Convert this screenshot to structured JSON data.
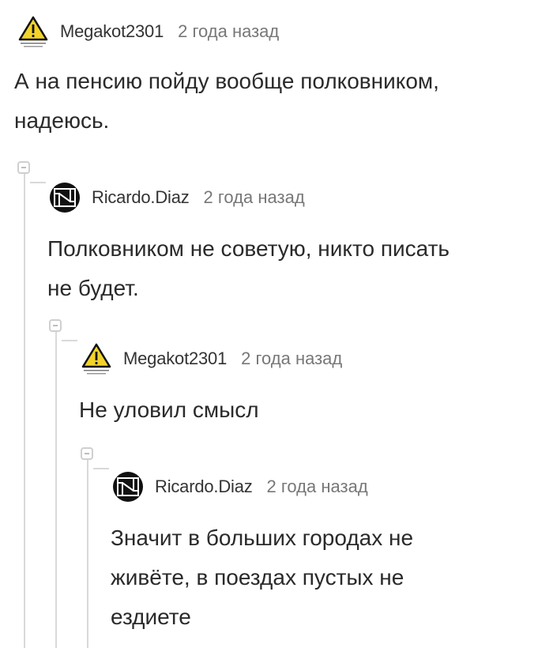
{
  "comments": [
    {
      "author": "Megakot2301",
      "time": "2 года назад",
      "lines": [
        "А на пенсию пойду вообще полковником,",
        "надеюсь."
      ],
      "avatar": "warning-sign-icon"
    },
    {
      "author": "Ricardo.Diaz",
      "time": "2 года назад",
      "lines": [
        "Полковником не советую, никто писать",
        "не будет."
      ],
      "avatar": "rammstein-logo-icon"
    },
    {
      "author": "Megakot2301",
      "time": "2 года назад",
      "lines": [
        "Не уловил смысл"
      ],
      "avatar": "warning-sign-icon"
    },
    {
      "author": "Ricardo.Diaz",
      "time": "2 года назад",
      "lines": [
        "Значит в больших городах не",
        "живёте, в поездах пустых не",
        "ездиете"
      ],
      "avatar": "rammstein-logo-icon"
    }
  ],
  "colors": {
    "thread_line": "#d9d9d9",
    "warning_yellow": "#f2d32a"
  }
}
